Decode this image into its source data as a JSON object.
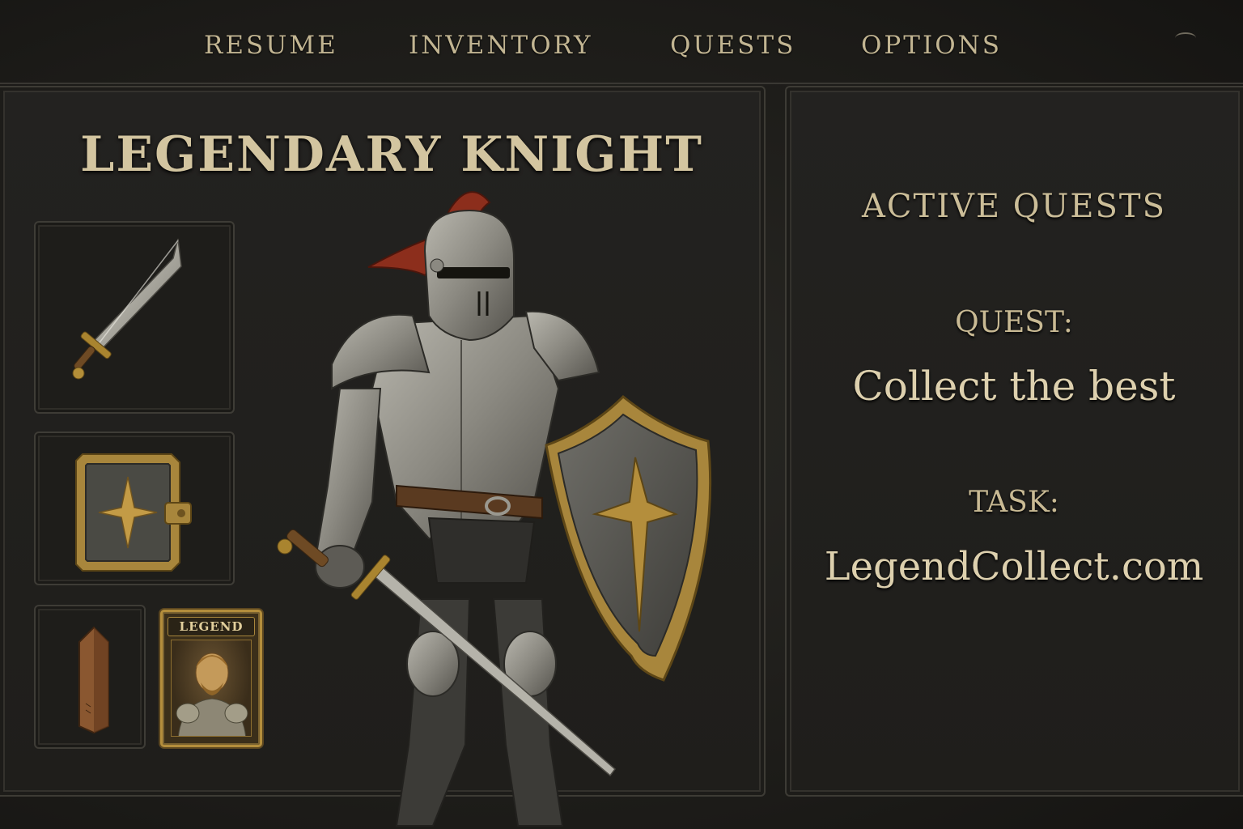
{
  "nav": {
    "items": [
      {
        "label": "RESUME"
      },
      {
        "label": "INVENTORY"
      },
      {
        "label": "QUESTS"
      },
      {
        "label": "OPTIONS"
      }
    ]
  },
  "character": {
    "title": "LEGENDARY KNIGHT"
  },
  "inventory": {
    "slots": [
      {
        "icon": "sword-icon"
      },
      {
        "icon": "tome-icon"
      },
      {
        "icon": "scroll-icon"
      },
      {
        "icon": "legend-card-icon",
        "label": "LEGEND"
      }
    ]
  },
  "quests": {
    "heading": "ACTIVE QUESTS",
    "quest_label": "QUEST:",
    "quest_value": "Collect the best",
    "task_label": "TASK:",
    "task_value": "LegendCollect.com"
  },
  "colors": {
    "background": "#1e1d1a",
    "text": "#cbbd9a",
    "gold": "#b48e3c",
    "panel_border": "#3d3b35"
  }
}
